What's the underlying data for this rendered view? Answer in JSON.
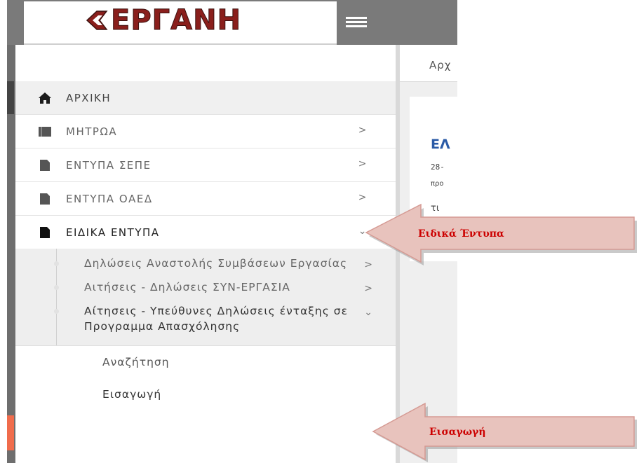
{
  "header": {
    "logo_text": "ΕΡΓΑΝΗ",
    "menu_icon": "hamburger-icon"
  },
  "breadcrumb": {
    "text": "Αρχ"
  },
  "sidebar": {
    "items": [
      {
        "label": "ΑΡΧΙΚΗ",
        "icon": "home-icon",
        "chevron": ""
      },
      {
        "label": "ΜΗΤΡΩΑ",
        "icon": "book-icon",
        "chevron": ">"
      },
      {
        "label": "ΕΝΤΥΠΑ ΣΕΠΕ",
        "icon": "document-icon",
        "chevron": ">"
      },
      {
        "label": "ΕΝΤΥΠΑ ΟΑΕΔ",
        "icon": "document-icon",
        "chevron": ">"
      },
      {
        "label": "ΕΙΔΙΚΑ ΕΝΤΥΠΑ",
        "icon": "document-icon",
        "chevron": "⌄"
      }
    ],
    "subitems": [
      {
        "label": "Δηλώσεις Αναστολής Συμβάσεων Εργασίας",
        "chevron": ">"
      },
      {
        "label": "Αιτήσεις - Δηλώσεις ΣΥΝ-ΕΡΓΑΣΙΑ",
        "chevron": ">"
      },
      {
        "label": "Αίτησεις - Υπεύθυνες Δηλώσεις ένταξης σε Προγραμμα Απασχόλησης",
        "chevron": "⌄"
      }
    ],
    "leaves": [
      {
        "label": "Αναζήτηση"
      },
      {
        "label": "Εισαγωγή"
      }
    ]
  },
  "content": {
    "title": "ΕΛ",
    "line1": "28-",
    "line2": "προ",
    "line3": "τι"
  },
  "callouts": [
    {
      "label": "Ειδικά  Έντυπα"
    },
    {
      "label": "Εισαγωγή"
    }
  ],
  "colors": {
    "topbar": "#7a7a7a",
    "logo": "#8a1f1c",
    "link_blue": "#2a5aa6",
    "callout_fill": "#e8c3bd",
    "callout_text": "#cc0000",
    "active_marker": "#f06c4c"
  }
}
